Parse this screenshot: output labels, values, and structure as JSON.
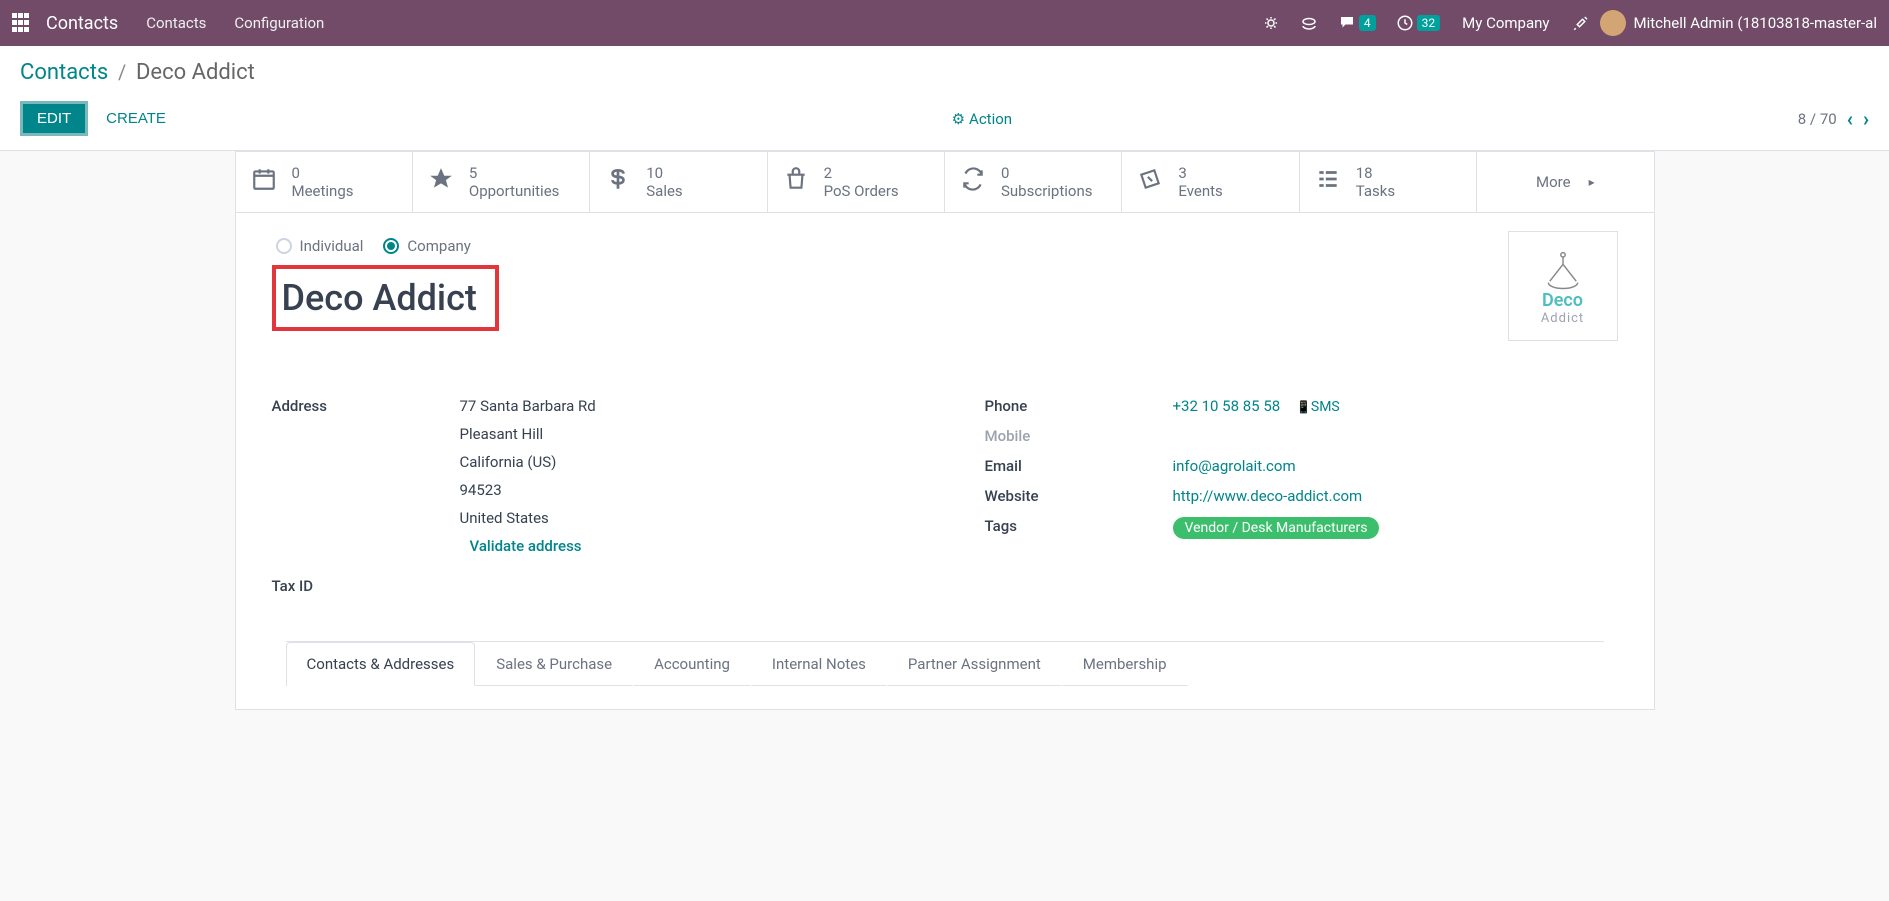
{
  "navbar": {
    "brand": "Contacts",
    "links": [
      "Contacts",
      "Configuration"
    ],
    "msg_badge": "4",
    "clock_badge": "32",
    "company": "My Company",
    "user": "Mitchell Admin (18103818-master-al"
  },
  "breadcrumb": {
    "root": "Contacts",
    "sep": "/",
    "current": "Deco Addict"
  },
  "controls": {
    "edit": "EDIT",
    "create": "CREATE",
    "action": "Action",
    "pager": "8 / 70"
  },
  "stats": [
    {
      "num": "0",
      "label": "Meetings"
    },
    {
      "num": "5",
      "label": "Opportunities"
    },
    {
      "num": "10",
      "label": "Sales"
    },
    {
      "num": "2",
      "label": "PoS Orders"
    },
    {
      "num": "0",
      "label": "Subscriptions"
    },
    {
      "num": "3",
      "label": "Events"
    },
    {
      "num": "18",
      "label": "Tasks"
    }
  ],
  "more_label": "More",
  "type_radio": {
    "individual": "Individual",
    "company": "Company"
  },
  "company_name": "Deco Addict",
  "logo": {
    "text": "Deco",
    "sub": "Addict"
  },
  "left_fields": {
    "address_label": "Address",
    "addr_street": "77 Santa Barbara Rd",
    "addr_city": "Pleasant Hill",
    "addr_state": "California (US)",
    "addr_zip": "94523",
    "addr_country": "United States",
    "validate": "Validate address",
    "taxid_label": "Tax ID"
  },
  "right_fields": {
    "phone_label": "Phone",
    "phone": "+32 10 58 85 58",
    "sms": "SMS",
    "mobile_label": "Mobile",
    "email_label": "Email",
    "email": "info@agrolait.com",
    "website_label": "Website",
    "website": "http://www.deco-addict.com",
    "tags_label": "Tags",
    "tag": "Vendor / Desk Manufacturers"
  },
  "tabs": [
    "Contacts & Addresses",
    "Sales & Purchase",
    "Accounting",
    "Internal Notes",
    "Partner Assignment",
    "Membership"
  ]
}
